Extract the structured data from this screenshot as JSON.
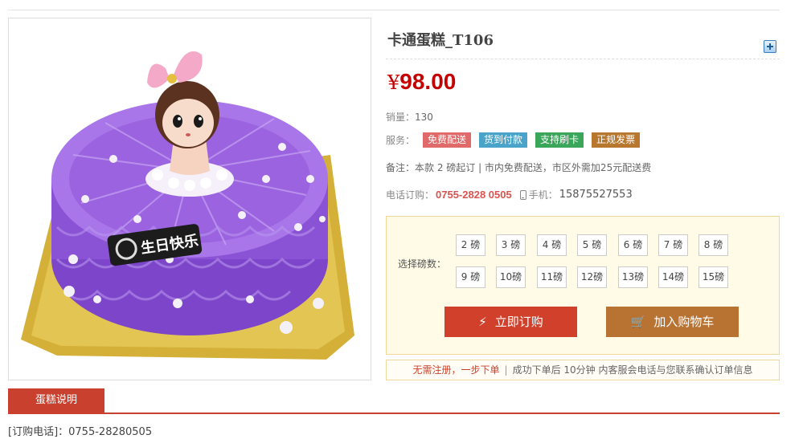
{
  "product": {
    "title": "卡通蛋糕_T106",
    "price_symbol": "¥",
    "price": "98.00",
    "sales_label": "销量：",
    "sales": "130",
    "services_label": "服务：",
    "services": [
      {
        "label": "免费配送",
        "color": "#e06a6a"
      },
      {
        "label": "货到付款",
        "color": "#4aa3c9"
      },
      {
        "label": "支持刷卡",
        "color": "#3aa65a"
      },
      {
        "label": "正规发票",
        "color": "#b8772e"
      }
    ],
    "note": "备注：本款 2 磅起订 | 市内免费配送，市区外需加25元配送费",
    "phone_label": "电话订购：",
    "phone": "0755-2828 0505",
    "mobile_label": "手机：",
    "mobile": "15875527553",
    "cake_topper_text": "生日快乐"
  },
  "selector": {
    "label": "选择磅数：",
    "weights": [
      "2 磅",
      "3 磅",
      "4 磅",
      "5 磅",
      "6 磅",
      "7 磅",
      "8 磅",
      "9 磅",
      "10磅",
      "11磅",
      "12磅",
      "13磅",
      "14磅",
      "15磅"
    ]
  },
  "actions": {
    "buy_now": "立即订购",
    "add_to_cart": "加入购物车"
  },
  "tip": {
    "highlight": "无需注册，一步下单",
    "separator": "|",
    "text": "成功下单后 10分钟 内客服会电话与您联系确认订单信息"
  },
  "tabs": {
    "description": "蛋糕说明"
  },
  "footer": {
    "order_phone": "[订购电话]：0755-28280505"
  },
  "colors": {
    "accent": "#c9412e",
    "price": "#c40000"
  }
}
